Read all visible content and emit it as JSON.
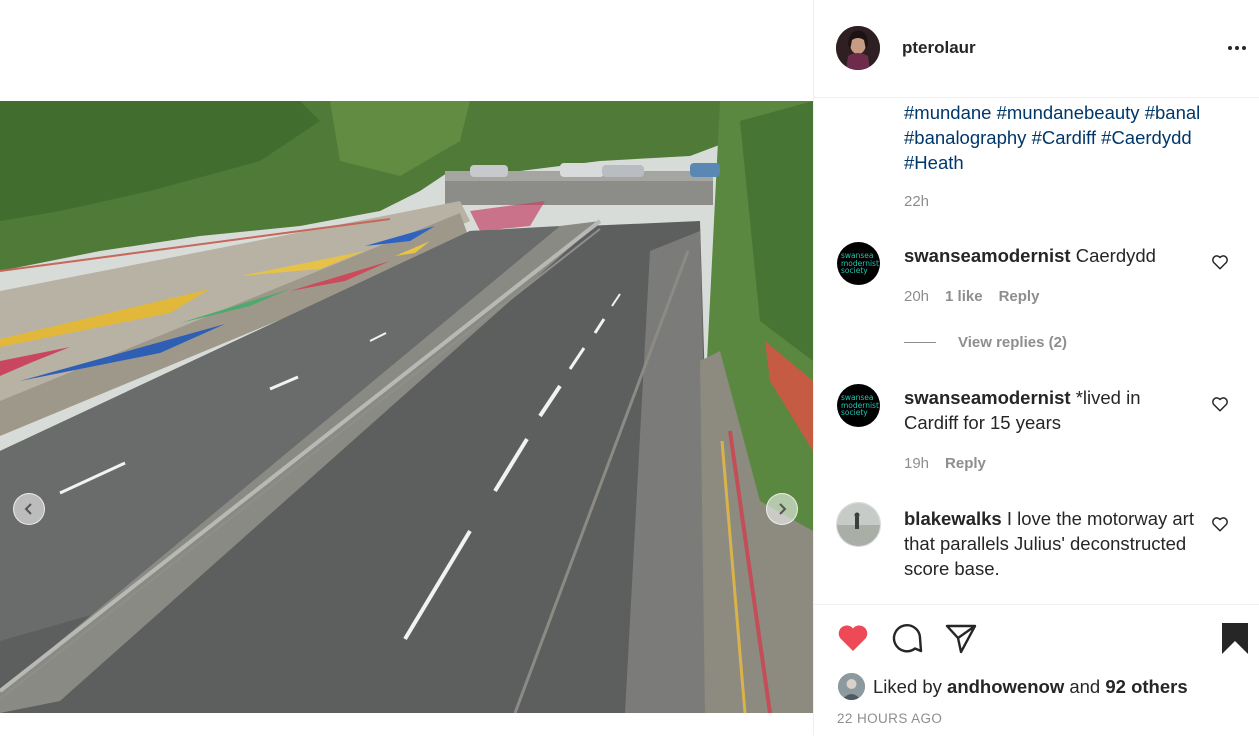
{
  "post": {
    "username": "pterolaur",
    "hashtags": [
      "#mundane",
      "#mundanebeauty",
      "#banal",
      "#banalography",
      "#Cardiff",
      "#Caerdydd",
      "#Heath"
    ],
    "caption_time": "22h"
  },
  "comments": [
    {
      "user": "swanseamodernist",
      "text": "Caerdydd",
      "time": "20h",
      "likes": "1 like",
      "reply": "Reply",
      "view_replies": "View replies (2)",
      "avatar": "swansea-modernist-society-logo"
    },
    {
      "user": "swanseamodernist",
      "text": "*lived in Cardiff for 15 years",
      "time": "19h",
      "reply": "Reply",
      "avatar": "swansea-modernist-society-logo"
    },
    {
      "user": "blakewalks",
      "text": "I love the motorway art that parallels Julius' deconstructed score base.",
      "avatar": "photo-avatar"
    }
  ],
  "logo_text": [
    "swansea",
    "modernist",
    "society"
  ],
  "likes": {
    "prefix": "Liked by",
    "user": "andhowenow",
    "and": "and",
    "others": "92 others"
  },
  "timestamp": "22 HOURS AGO",
  "icons": {
    "like": "heart-filled-icon",
    "comment": "comment-icon",
    "share": "paper-plane-icon",
    "save": "bookmark-filled-icon",
    "more": "more-horizontal-icon",
    "prev": "chevron-left-icon",
    "next": "chevron-right-icon"
  },
  "colors": {
    "like_red": "#ed4956",
    "hashtag_blue": "#00376b",
    "muted": "#8e8e8e",
    "text": "#262626",
    "logo_teal": "#22c4b0"
  }
}
